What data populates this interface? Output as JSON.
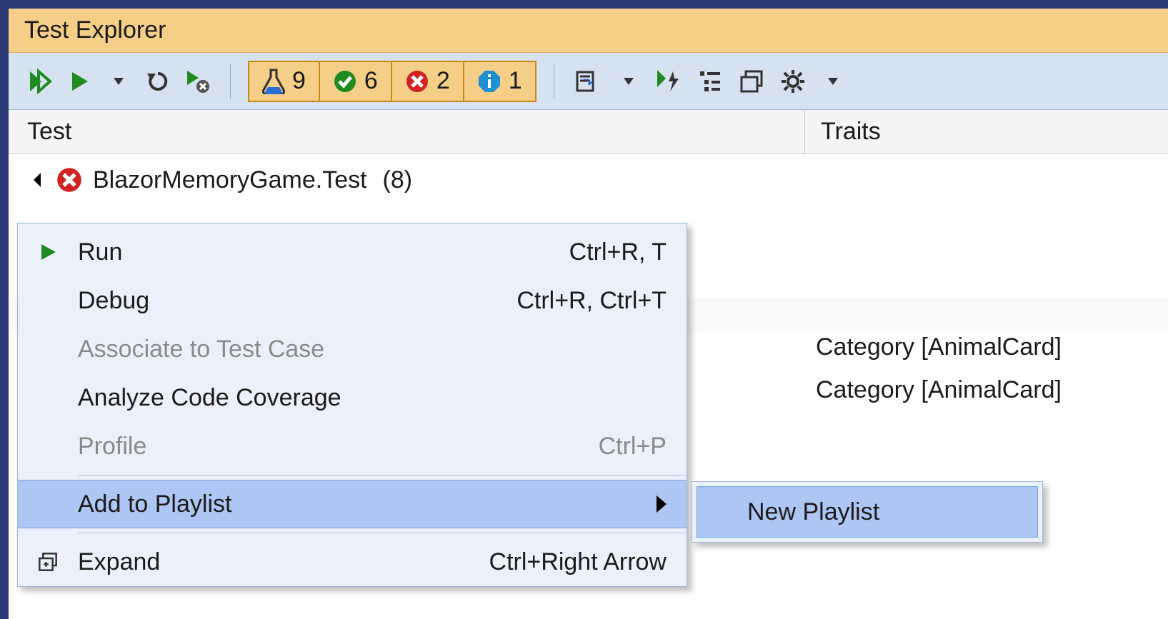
{
  "title": "Test Explorer",
  "toolbar": {
    "counts": {
      "total": "9",
      "passed": "6",
      "failed": "2",
      "info": "1"
    }
  },
  "columns": {
    "test": "Test",
    "traits": "Traits"
  },
  "tree": {
    "root_label": "BlazorMemoryGame.Test",
    "root_count": "(8)"
  },
  "traits": {
    "row1": "Category [AnimalCard]",
    "row2": "Category [AnimalCard]"
  },
  "context_menu": {
    "run": {
      "label": "Run",
      "shortcut": "Ctrl+R, T"
    },
    "debug": {
      "label": "Debug",
      "shortcut": "Ctrl+R, Ctrl+T"
    },
    "associate": {
      "label": "Associate to Test Case"
    },
    "analyze": {
      "label": "Analyze Code Coverage"
    },
    "profile": {
      "label": "Profile",
      "shortcut": "Ctrl+P"
    },
    "add_playlist": {
      "label": "Add to Playlist"
    },
    "expand": {
      "label": "Expand",
      "shortcut": "Ctrl+Right Arrow"
    }
  },
  "submenu": {
    "new_playlist": "New Playlist"
  }
}
